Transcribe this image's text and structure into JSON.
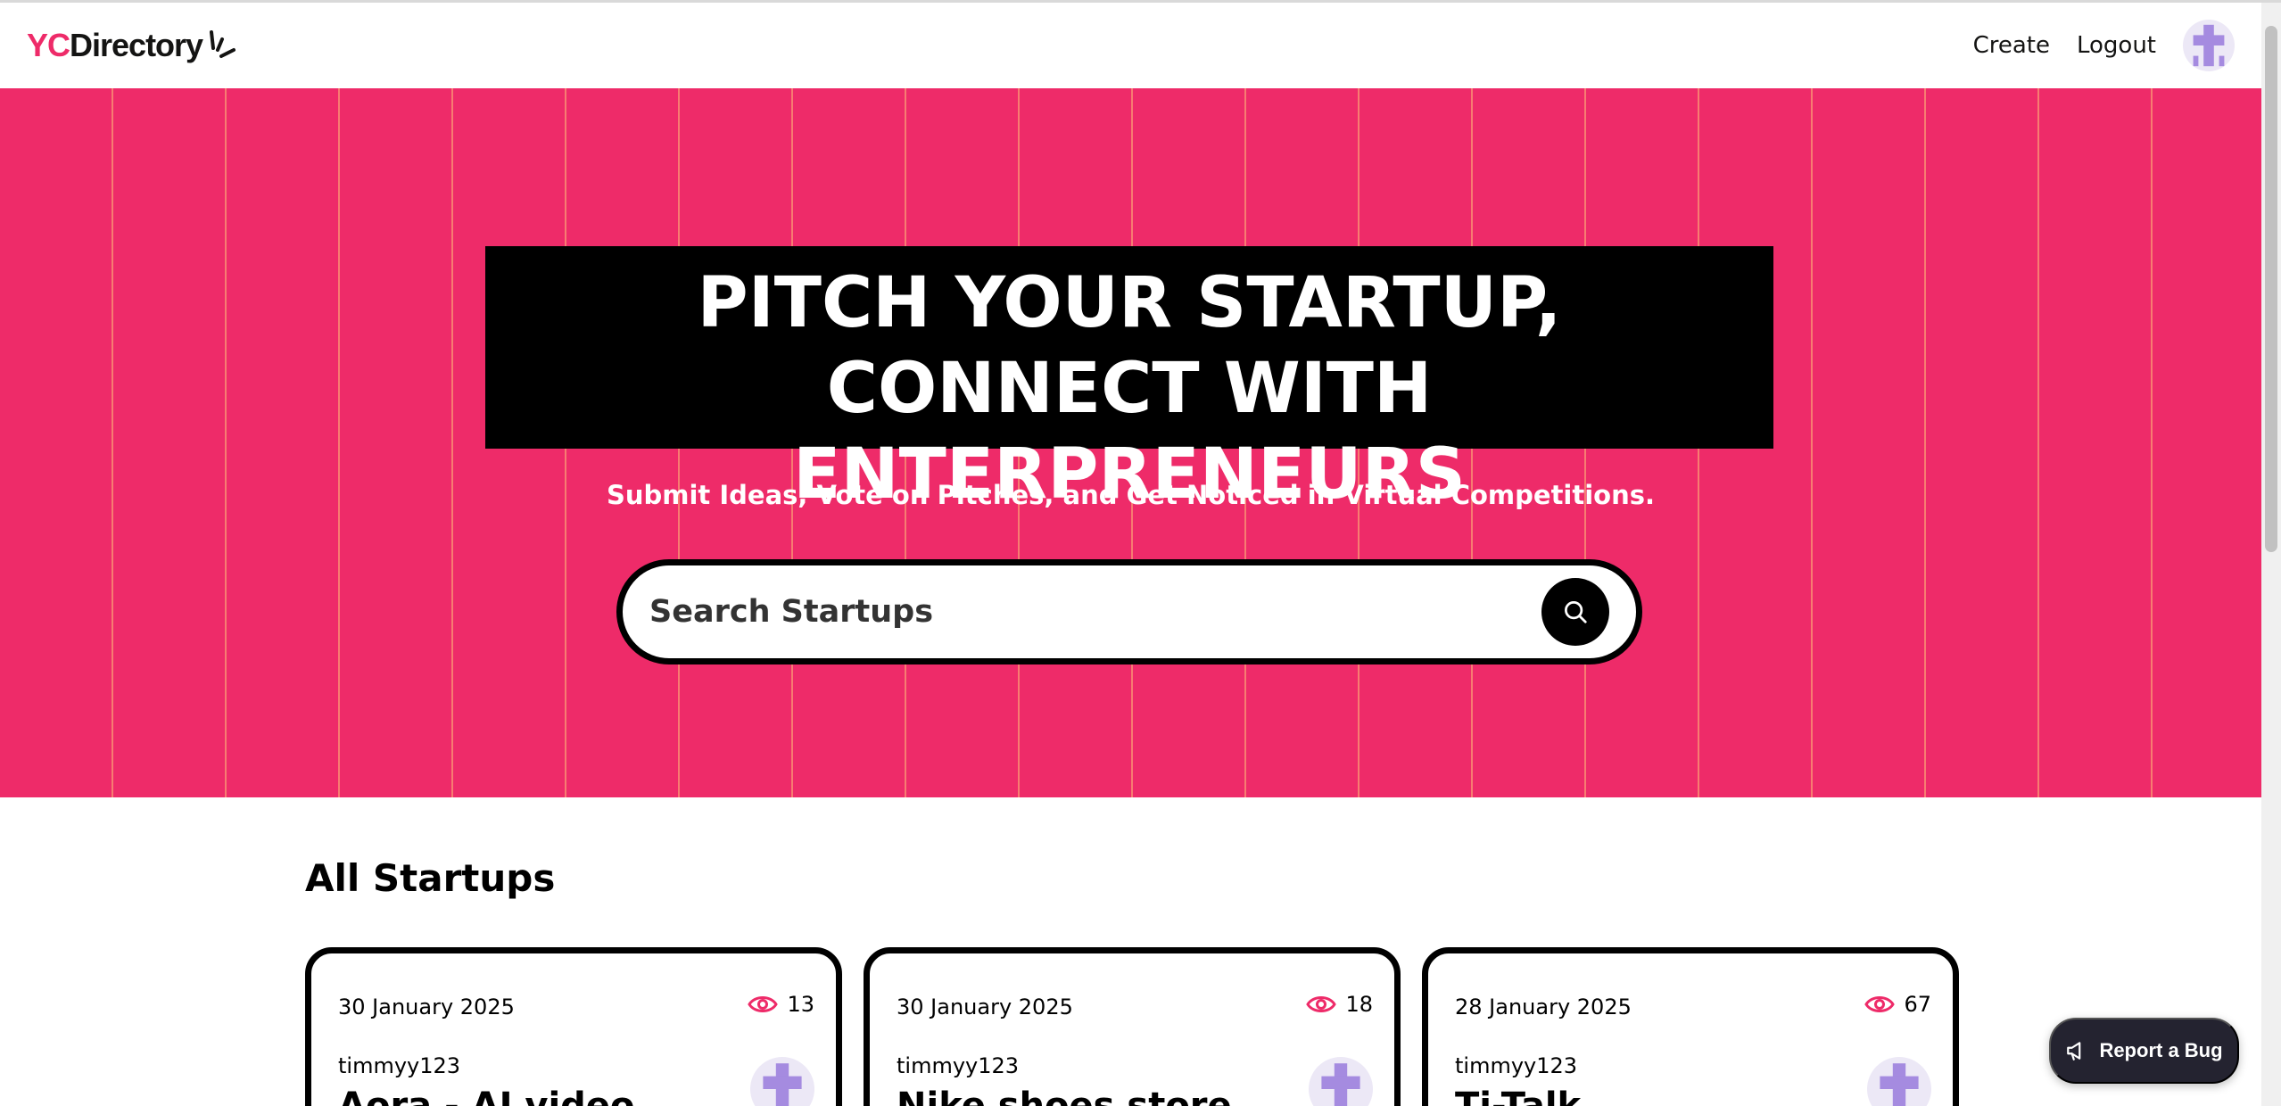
{
  "navbar": {
    "logo_yc": "YC",
    "logo_directory": "Directory",
    "create_label": "Create",
    "logout_label": "Logout",
    "avatar_icon": "user-avatar-icon"
  },
  "hero": {
    "title_line1": "PITCH YOUR STARTUP,",
    "title_line2": "CONNECT WITH ENTERPRENEURS",
    "subtitle": "Submit Ideas, Vote on Pitches, and Get Noticed in Virtual Competitions.",
    "search_placeholder": "Search Startups",
    "search_icon": "search-icon",
    "background_color": "#ee2b69"
  },
  "startups": {
    "section_title": "All Startups",
    "cards": [
      {
        "date": "30 January 2025",
        "views": "13",
        "author": "timmyy123",
        "title": "Aora - AI video"
      },
      {
        "date": "30 January 2025",
        "views": "18",
        "author": "timmyy123",
        "title": "Nike shoes store"
      },
      {
        "date": "28 January 2025",
        "views": "67",
        "author": "timmyy123",
        "title": "Ti-Talk"
      }
    ]
  },
  "report_bug": {
    "label": "Report a Bug",
    "icon": "megaphone-icon"
  },
  "colors": {
    "accent": "#ee2b69",
    "dark": "#000000",
    "avatar_bg": "#ece8f6",
    "avatar_fg": "#a58be0"
  }
}
